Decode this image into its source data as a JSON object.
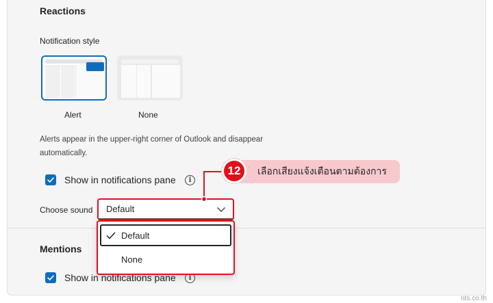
{
  "reactions": {
    "title": "Reactions",
    "notification_style_label": "Notification style",
    "styles": [
      {
        "label": "Alert",
        "selected": true
      },
      {
        "label": "None",
        "selected": false
      }
    ],
    "description_line1": "Alerts appear in the upper-right corner of Outlook and disappear",
    "description_line2": "automatically.",
    "show_in_pane": {
      "label": "Show in notifications pane",
      "checked": true
    },
    "choose_sound_label": "Choose sound",
    "sound_dropdown": {
      "value": "Default"
    }
  },
  "sound_menu": {
    "options": [
      {
        "label": "Default",
        "selected": true
      },
      {
        "label": "None",
        "selected": false
      }
    ]
  },
  "mentions": {
    "title": "Mentions",
    "show_in_pane": {
      "label": "Show in notifications pane",
      "checked": true
    }
  },
  "annotation": {
    "step_number": "12",
    "text": "เลือกเสียงแจ้งเตือนตามต้องการ",
    "color": "#e0101a",
    "callout_bg": "#f7c9cd"
  },
  "accent_color": "#0f6cbd",
  "watermark": "nts.co.th"
}
